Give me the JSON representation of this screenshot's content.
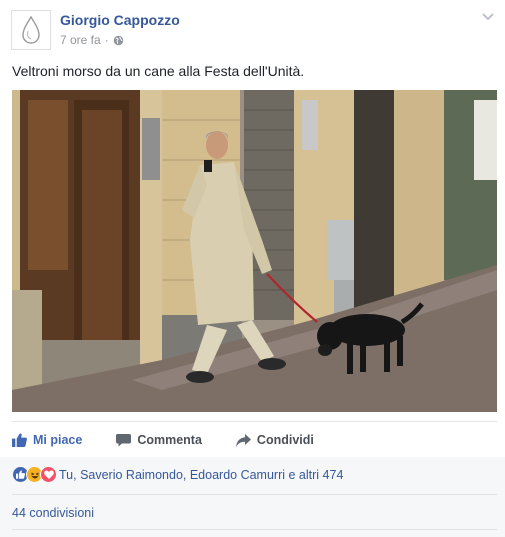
{
  "post": {
    "author": "Giorgio Cappozzo",
    "time": "7 ore fa",
    "separator": "·",
    "privacy_icon": "globe-icon",
    "message": "Veltroni morso da un cane alla Festa dell'Unità."
  },
  "actions": {
    "like": "Mi piace",
    "comment": "Commenta",
    "share": "Condividi"
  },
  "reactions": {
    "icons": [
      "like-reaction-icon",
      "haha-reaction-icon",
      "love-reaction-icon"
    ],
    "summary": "Tu, Saverio Raimondo, Edoardo Camurri e altri 474"
  },
  "shares": "44 condivisioni",
  "colors": {
    "link": "#365899",
    "liked": "#4267b2",
    "love": "#f25268",
    "haha": "#f7b125"
  }
}
